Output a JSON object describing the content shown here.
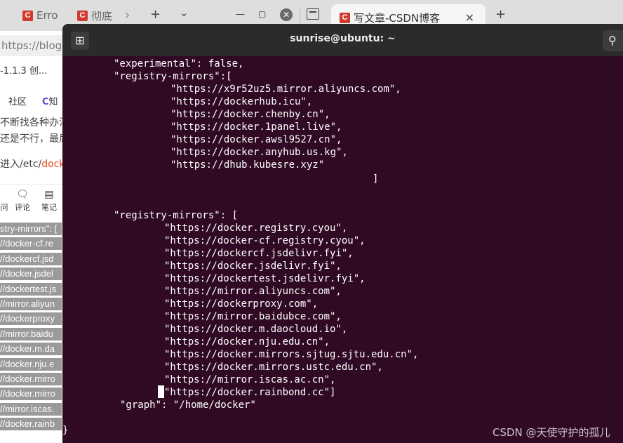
{
  "browser": {
    "tabs": [
      {
        "favicon": "C",
        "label": "Erro"
      },
      {
        "favicon": "C",
        "label": "彻底"
      },
      {
        "favicon": "C",
        "label": "写文章-CSDN博客"
      }
    ],
    "left_page": {
      "url": "https://blog",
      "bookmark": "-1.1.3 创...",
      "nav": [
        "社区",
        "知"
      ],
      "paragraphs": [
        "不断找各种办法",
        "还是不行，最后",
        "进入/etc/"
      ],
      "highlight": "docker",
      "toolbar": [
        "问",
        "评论",
        "笔记"
      ],
      "code_lines": [
        "stry-mirrors\": [",
        "//docker-cf.re",
        "//dockercf.jsd",
        "//docker.jsdel",
        "//dockertest.js",
        "//mirror.aliyun",
        "//dockerproxy",
        "//mirror.baidu",
        "//docker.m.da",
        "//docker.nju.e",
        "//docker.mirro",
        "//docker.mirro",
        "//mirror.iscas.",
        "//docker.rainb"
      ]
    }
  },
  "terminal": {
    "title": "sunrise@ubuntu: ~",
    "lines": [
      "\"experimental\": false,",
      "\"registry-mirrors\":[",
      "\"https://x9r52uz5.mirror.aliyuncs.com\",",
      "\"https://dockerhub.icu\",",
      "\"https://docker.chenby.cn\",",
      "\"https://docker.1panel.live\",",
      "\"https://docker.awsl9527.cn\",",
      "\"https://docker.anyhub.us.kg\",",
      "\"https://dhub.kubesre.xyz\"",
      "]",
      "\"registry-mirrors\": [",
      "\"https://docker.registry.cyou\",",
      "\"https://docker-cf.registry.cyou\",",
      "\"https://dockercf.jsdelivr.fyi\",",
      "\"https://docker.jsdelivr.fyi\",",
      "\"https://dockertest.jsdelivr.fyi\",",
      "\"https://mirror.aliyuncs.com\",",
      "\"https://dockerproxy.com\",",
      "\"https://mirror.baidubce.com\",",
      "\"https://docker.m.daocloud.io\",",
      "\"https://docker.nju.edu.cn\",",
      "\"https://docker.mirrors.sjtug.sjtu.edu.cn\",",
      "\"https://docker.mirrors.ustc.edu.cn\",",
      "\"https://mirror.iscas.ac.cn\",",
      "\"https://docker.rainbond.cc\"]",
      "\"graph\": \"/home/docker\"",
      "}"
    ]
  },
  "watermark": "CSDN @天使守护的孤儿"
}
